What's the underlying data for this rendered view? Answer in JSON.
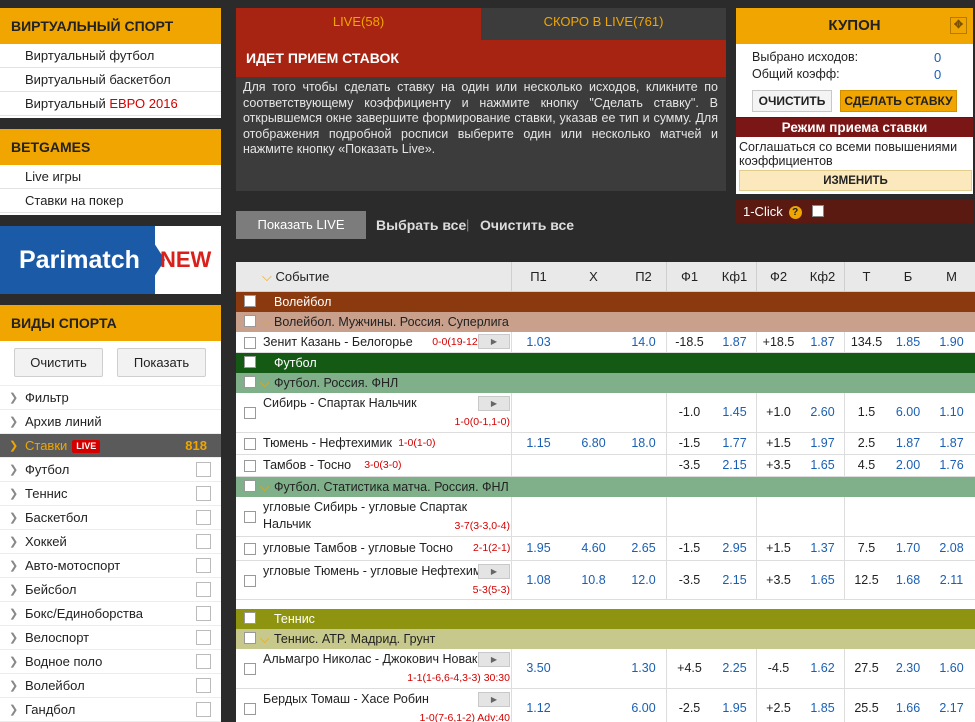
{
  "left": {
    "virtual": {
      "title": "ВИРТУАЛЬНЫЙ СПОРТ",
      "items": [
        "Виртуальный футбол",
        "Виртуальный баскетбол"
      ],
      "euro_prefix": "Виртуальный ",
      "euro_red": "ЕВРО 2016"
    },
    "betgames": {
      "title": "BETGAMES",
      "items": [
        "Live игры",
        "Ставки на покер"
      ]
    },
    "banner": {
      "brand": "Parimatch",
      "badge": "NEW"
    },
    "sports": {
      "title": "ВИДЫ СПОРТА",
      "clear": "Очистить",
      "show": "Показать",
      "items": [
        "Фильтр",
        "Архив линий",
        "Ставки",
        "Футбол",
        "Теннис",
        "Баскетбол",
        "Хоккей",
        "Авто-мотоспорт",
        "Бейсбол",
        "Бокс/Единоборства",
        "Велоспорт",
        "Водное поло",
        "Волейбол",
        "Гандбол"
      ],
      "live_tag": "LIVE",
      "live_count": "818"
    }
  },
  "tabs": {
    "live": "LIVE(58)",
    "soon": "СКОРО В LIVE(761)"
  },
  "info": {
    "title": "ИДЕТ ПРИЕМ СТАВОК",
    "text": "Для того чтобы сделать ставку на один или несколько исходов, кликните по соответствующему коэффициенту и нажмите кнопку \"Сделать ставку\". В открывшемся окне завершите формирование ставки, указав ее тип и сумму. Для отображения подробной росписи выберите один или несколько матчей и нажмите кнопку «Показать Live»."
  },
  "actions": {
    "show_live": "Показать LIVE",
    "select_all": "Выбрать все",
    "clear_all": "Очистить все",
    "sep": "|"
  },
  "coupon": {
    "title": "КУПОН",
    "pin": "✥",
    "selected_label": "Выбрано исходов:",
    "selected": "0",
    "total_label": "Общий коэфф:",
    "total": "0",
    "clear": "ОЧИСТИТЬ",
    "bet": "СДЕЛАТЬ СТАВКУ"
  },
  "mode": {
    "title": "Режим приема ставки",
    "text": "Соглашаться со всеми повышениями коэффициентов",
    "button": "ИЗМЕНИТЬ"
  },
  "oneclick": {
    "label": "1-Click",
    "help": "?"
  },
  "table": {
    "headers": [
      "Событие",
      "П1",
      "X",
      "П2",
      "Ф1",
      "Кф1",
      "Ф2",
      "Кф2",
      "Т",
      "Б",
      "М"
    ],
    "sections": [
      {
        "name": "Волейбол",
        "color": "#8b3a10",
        "subs": [
          {
            "name": "Волейбол. Мужчины. Россия. Суперлига",
            "color": "#c8a08c",
            "rows": [
              {
                "event": "Зенит Казань - Белогорье",
                "score": "0-0(19-12)",
                "odds": [
                  "1.03",
                  "",
                  "14.0",
                  "-18.5",
                  "1.87",
                  "+18.5",
                  "1.87",
                  "134.5",
                  "1.85",
                  "1.90"
                ]
              }
            ]
          }
        ]
      },
      {
        "name": "Футбол",
        "color": "#145a14",
        "subs": [
          {
            "name": "Футбол. Россия. ФНЛ",
            "color": "#7fb08a",
            "rows": [
              {
                "event": "Сибирь - Спартак Нальчик",
                "score": "1-0(0-1,1-0)",
                "odds": [
                  "",
                  "",
                  "",
                  "-1.0",
                  "1.45",
                  "+1.0",
                  "2.60",
                  "1.5",
                  "6.00",
                  "1.10"
                ]
              },
              {
                "event": "Тюмень - Нефтехимик",
                "score": "1-0(1-0)",
                "odds": [
                  "1.15",
                  "6.80",
                  "18.0",
                  "-1.5",
                  "1.77",
                  "+1.5",
                  "1.97",
                  "2.5",
                  "1.87",
                  "1.87"
                ]
              },
              {
                "event": "Тамбов - Тосно",
                "score": "3-0(3-0)",
                "odds": [
                  "",
                  "",
                  "",
                  "-3.5",
                  "2.15",
                  "+3.5",
                  "1.65",
                  "4.5",
                  "2.00",
                  "1.76"
                ]
              }
            ]
          },
          {
            "name": "Футбол. Статистика матча. Россия. ФНЛ",
            "color": "#7fb08a",
            "rows": [
              {
                "event": "угловые Сибирь - угловые Спартак",
                "event2": "Нальчик",
                "score": "3-7(3-3,0-4)",
                "odds": [
                  "",
                  "",
                  "",
                  "",
                  "",
                  "",
                  "",
                  "",
                  "",
                  ""
                ]
              },
              {
                "event": "угловые Тамбов - угловые Тосно",
                "score": "2-1(2-1)",
                "odds": [
                  "1.95",
                  "4.60",
                  "2.65",
                  "-1.5",
                  "2.95",
                  "+1.5",
                  "1.37",
                  "7.5",
                  "1.70",
                  "2.08"
                ]
              },
              {
                "event": "угловые Тюмень - угловые Нефтехимик",
                "score": "5-3(5-3)",
                "odds": [
                  "1.08",
                  "10.8",
                  "12.0",
                  "-3.5",
                  "2.15",
                  "+3.5",
                  "1.65",
                  "12.5",
                  "1.68",
                  "2.11"
                ]
              }
            ]
          }
        ]
      },
      {
        "name": "Теннис",
        "color": "#8e9410",
        "subs": [
          {
            "name": "Теннис. ATP. Мадрид. Грунт",
            "color": "#c7c98c",
            "rows": [
              {
                "event": "Альмагро Николас - Джокович Новак",
                "score": "1-1(1-6,6-4,3-3) 30:30",
                "odds": [
                  "3.50",
                  "",
                  "1.30",
                  "+4.5",
                  "2.25",
                  "-4.5",
                  "1.62",
                  "27.5",
                  "2.30",
                  "1.60"
                ]
              },
              {
                "event": "Бердых Томаш - Хасе Робин",
                "score": "1-0(7-6,1-2) Adv:40",
                "odds": [
                  "1.12",
                  "",
                  "6.00",
                  "-2.5",
                  "1.95",
                  "+2.5",
                  "1.85",
                  "25.5",
                  "1.66",
                  "2.17"
                ]
              }
            ]
          }
        ]
      }
    ]
  }
}
